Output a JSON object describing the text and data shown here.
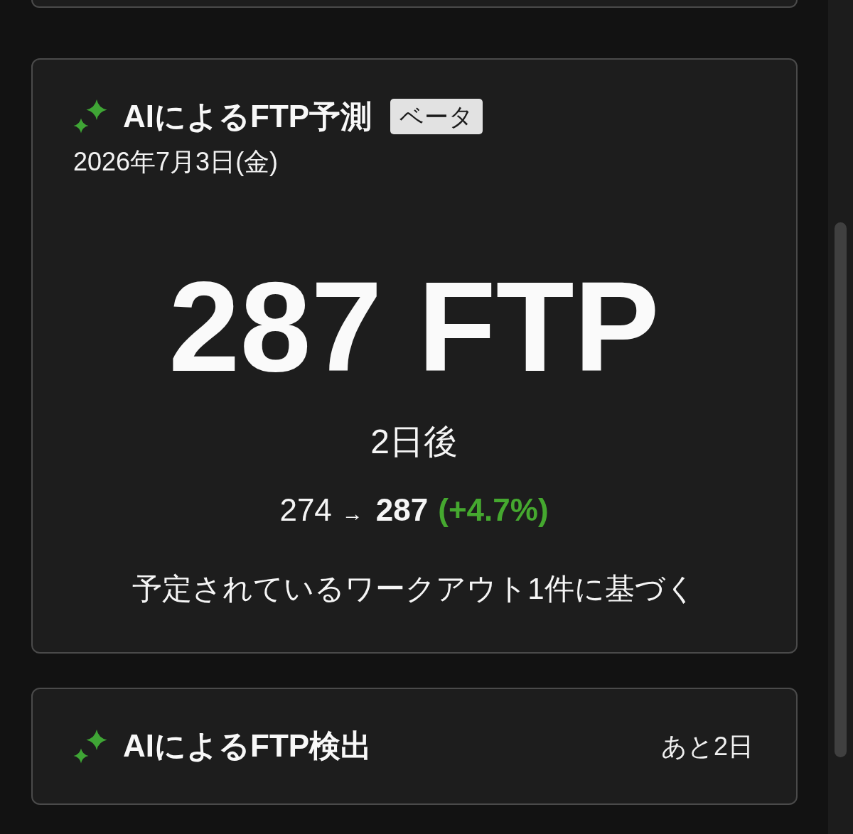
{
  "prediction_card": {
    "title": "AIによるFTP予測",
    "badge": "ベータ",
    "date": "2026年7月3日(金)",
    "value": "287 FTP",
    "timeframe": "2日後",
    "change": {
      "from": "274",
      "arrow": "→",
      "to": "287",
      "percent": "(+4.7%)"
    },
    "basis": "予定されているワークアウト1件に基づく"
  },
  "detection_card": {
    "title": "AIによるFTP検出",
    "remaining": "あと2日"
  }
}
